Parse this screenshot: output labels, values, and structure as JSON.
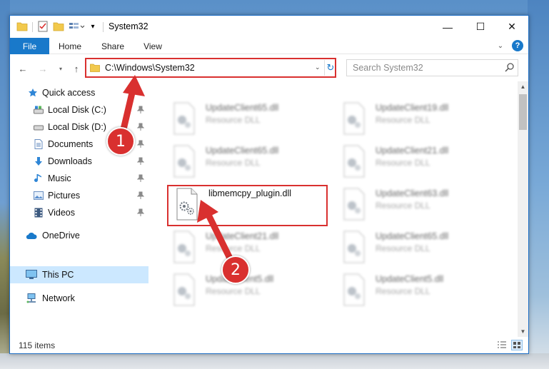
{
  "window": {
    "title": "System32",
    "buttons": {
      "minimize": "—",
      "maximize": "☐",
      "close": "✕"
    }
  },
  "ribbon": {
    "tabs": [
      "File",
      "Home",
      "Share",
      "View"
    ]
  },
  "nav": {
    "address": "C:\\Windows\\System32",
    "search_placeholder": "Search System32"
  },
  "sidebar": {
    "items": [
      {
        "label": "Quick access",
        "icon": "star-icon",
        "pinned": false
      },
      {
        "label": "Local Disk (C:)",
        "icon": "drive-icon",
        "pinned": true
      },
      {
        "label": "Local Disk (D:)",
        "icon": "drive-icon",
        "pinned": true
      },
      {
        "label": "Documents",
        "icon": "documents-icon",
        "pinned": true
      },
      {
        "label": "Downloads",
        "icon": "download-icon",
        "pinned": true
      },
      {
        "label": "Music",
        "icon": "music-icon",
        "pinned": true
      },
      {
        "label": "Pictures",
        "icon": "pictures-icon",
        "pinned": true
      },
      {
        "label": "Videos",
        "icon": "videos-icon",
        "pinned": true
      },
      {
        "label": "OneDrive",
        "icon": "cloud-icon",
        "pinned": false
      },
      {
        "label": "This PC",
        "icon": "computer-icon",
        "pinned": false,
        "selected": true
      },
      {
        "label": "Network",
        "icon": "network-icon",
        "pinned": false
      }
    ]
  },
  "files": [
    {
      "name": "UpdateClient65.dll",
      "type": "Resource DLL",
      "blurred": true
    },
    {
      "name": "UpdateClient19.dll",
      "type": "Resource DLL",
      "blurred": true
    },
    {
      "name": "UpdateClient65.dll",
      "type": "Resource DLL",
      "blurred": true
    },
    {
      "name": "UpdateClient21.dll",
      "type": "Resource DLL",
      "blurred": true
    },
    {
      "name": "libmemcpy_plugin.dll",
      "type": "",
      "blurred": false,
      "highlighted": true
    },
    {
      "name": "UpdateClient63.dll",
      "type": "Resource DLL",
      "blurred": true
    },
    {
      "name": "UpdateClient21.dll",
      "type": "Resource DLL",
      "blurred": true
    },
    {
      "name": "UpdateClient65.dll",
      "type": "Resource DLL",
      "blurred": true
    },
    {
      "name": "UpdateClient5.dll",
      "type": "Resource DLL",
      "blurred": true
    },
    {
      "name": "UpdateClient5.dll",
      "type": "Resource DLL",
      "blurred": true
    }
  ],
  "status": {
    "item_count": "115 items"
  },
  "annotations": {
    "badge_1": "1",
    "badge_2": "2",
    "color": "#d9302f"
  },
  "colors": {
    "accent": "#1979ca",
    "selection": "#cce8ff",
    "highlight": "#d9302f"
  }
}
